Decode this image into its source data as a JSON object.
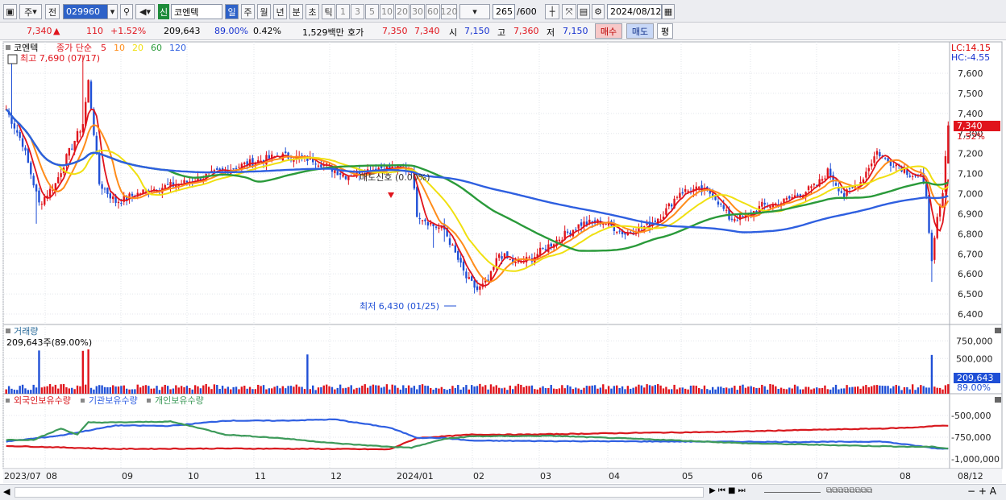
{
  "toolbar": {
    "type": "주",
    "prev": "전",
    "code": "029960",
    "new_badge": "신",
    "name": "코엔텍",
    "periods": [
      "일",
      "주",
      "월",
      "년",
      "분",
      "초",
      "틱"
    ],
    "intervals": [
      "1",
      "3",
      "5",
      "10",
      "20",
      "30",
      "60",
      "120"
    ],
    "count": "265",
    "count_total": "/600",
    "date": "2024/08/12"
  },
  "quote": {
    "price": "7,340",
    "arrow": "▲",
    "change": "110",
    "pct": "+1.52%",
    "volume": "209,643",
    "vol_ratio": "89.00%",
    "turnover": "0.42%",
    "amount": "1,529백만",
    "hoga_label": "호가",
    "ask": "7,350",
    "bid": "7,340",
    "open_label": "시",
    "open": "7,150",
    "high_label": "고",
    "high": "7,360",
    "low_label": "저",
    "low": "7,150",
    "buy": "매수",
    "sell": "매도",
    "eval": "평"
  },
  "price_pane": {
    "title": "코엔텍",
    "legend": [
      "종가 단순",
      "5",
      "10",
      "20",
      "60",
      "120"
    ],
    "high_note": "최고 7,690 (07/17)",
    "low_note": "최저 6,430 (01/25)",
    "signal": "매도신호 (0.00%)",
    "lc": "LC:14.15",
    "hc": "HC:-4.55",
    "last_tag": "7,340",
    "last_pct": "1.52%"
  },
  "volume_pane": {
    "title": "거래량",
    "note": "209,643주(89.00%)",
    "last": "209,643",
    "last_pct": "89.00%"
  },
  "holder_pane": {
    "series": [
      "외국인보유수량",
      "기관보유수량",
      "개인보유수량"
    ]
  },
  "x_labels": [
    "2023/07",
    "08",
    "09",
    "10",
    "11",
    "12",
    "2024/01",
    "02",
    "03",
    "04",
    "05",
    "06",
    "07",
    "08"
  ],
  "x_right": "08/12",
  "colors": {
    "ma5": "#e0141c",
    "ma10": "#ff8c1a",
    "ma20": "#f0e010",
    "ma60": "#2a9a3a",
    "ma120": "#2e5fe0",
    "up": "#e0141c",
    "down": "#1f4fd6",
    "foreign": "#d8171d",
    "inst": "#2f5fe2",
    "indiv": "#3d9a5a"
  },
  "chart_data": {
    "type": "candlestick",
    "price": {
      "y_ticks": [
        6400,
        6500,
        6600,
        6700,
        6800,
        6900,
        7000,
        7100,
        7200,
        7300,
        7400,
        7500,
        7600
      ],
      "ylim": [
        6350,
        7750
      ],
      "close_anchors": [
        [
          0,
          7420
        ],
        [
          6,
          7250
        ],
        [
          12,
          6950
        ],
        [
          18,
          7050
        ],
        [
          22,
          7180
        ],
        [
          28,
          7350
        ],
        [
          30,
          7560
        ],
        [
          34,
          7050
        ],
        [
          40,
          6960
        ],
        [
          52,
          7020
        ],
        [
          64,
          7050
        ],
        [
          76,
          7100
        ],
        [
          88,
          7150
        ],
        [
          100,
          7190
        ],
        [
          112,
          7170
        ],
        [
          124,
          7090
        ],
        [
          136,
          7130
        ],
        [
          148,
          7120
        ],
        [
          150,
          6900
        ],
        [
          156,
          6840
        ],
        [
          160,
          6820
        ],
        [
          164,
          6700
        ],
        [
          168,
          6580
        ],
        [
          172,
          6520
        ],
        [
          176,
          6560
        ],
        [
          180,
          6700
        ],
        [
          186,
          6650
        ],
        [
          192,
          6680
        ],
        [
          200,
          6760
        ],
        [
          210,
          6850
        ],
        [
          218,
          6860
        ],
        [
          226,
          6800
        ],
        [
          234,
          6840
        ],
        [
          240,
          6900
        ],
        [
          246,
          7010
        ],
        [
          252,
          7020
        ],
        [
          258,
          7000
        ],
        [
          264,
          6880
        ],
        [
          270,
          6880
        ],
        [
          276,
          6940
        ],
        [
          282,
          6950
        ],
        [
          290,
          7000
        ],
        [
          296,
          7040
        ],
        [
          300,
          7110
        ],
        [
          306,
          6990
        ],
        [
          312,
          7060
        ],
        [
          318,
          7210
        ],
        [
          322,
          7160
        ],
        [
          326,
          7140
        ],
        [
          330,
          7100
        ],
        [
          334,
          7080
        ],
        [
          336,
          7000
        ],
        [
          338,
          6650
        ],
        [
          340,
          6870
        ],
        [
          342,
          7000
        ],
        [
          344,
          7340
        ]
      ],
      "spikes": [
        [
          2,
          7690
        ],
        [
          28,
          7690
        ],
        [
          30,
          7470
        ],
        [
          11,
          6850
        ],
        [
          156,
          6730
        ],
        [
          160,
          6760
        ],
        [
          338,
          6560
        ]
      ]
    },
    "volume": {
      "y_ticks": [
        250000,
        500000,
        750000
      ],
      "n": 345
    },
    "holdings": {
      "y_ticks": [
        -1000000,
        -750000,
        -500000
      ],
      "foreign": [
        [
          0,
          -850
        ],
        [
          40,
          -885
        ],
        [
          80,
          -880
        ],
        [
          120,
          -885
        ],
        [
          140,
          -890
        ],
        [
          150,
          -760
        ],
        [
          170,
          -720
        ],
        [
          190,
          -720
        ],
        [
          200,
          -715
        ],
        [
          230,
          -700
        ],
        [
          260,
          -690
        ],
        [
          290,
          -668
        ],
        [
          320,
          -650
        ],
        [
          330,
          -640
        ],
        [
          340,
          -620
        ],
        [
          344,
          -615
        ]
      ],
      "inst": [
        [
          0,
          -800
        ],
        [
          20,
          -730
        ],
        [
          40,
          -615
        ],
        [
          60,
          -620
        ],
        [
          80,
          -560
        ],
        [
          100,
          -560
        ],
        [
          120,
          -545
        ],
        [
          140,
          -640
        ],
        [
          150,
          -755
        ],
        [
          160,
          -760
        ],
        [
          170,
          -790
        ],
        [
          200,
          -795
        ],
        [
          250,
          -800
        ],
        [
          290,
          -805
        ],
        [
          320,
          -800
        ],
        [
          334,
          -855
        ],
        [
          340,
          -880
        ],
        [
          344,
          -880
        ]
      ],
      "indiv": [
        [
          0,
          -780
        ],
        [
          10,
          -780
        ],
        [
          20,
          -650
        ],
        [
          26,
          -720
        ],
        [
          30,
          -580
        ],
        [
          40,
          -580
        ],
        [
          60,
          -570
        ],
        [
          70,
          -640
        ],
        [
          80,
          -720
        ],
        [
          100,
          -760
        ],
        [
          120,
          -820
        ],
        [
          140,
          -860
        ],
        [
          148,
          -870
        ],
        [
          160,
          -770
        ],
        [
          170,
          -740
        ],
        [
          200,
          -735
        ],
        [
          240,
          -780
        ],
        [
          270,
          -820
        ],
        [
          300,
          -840
        ],
        [
          330,
          -860
        ],
        [
          338,
          -860
        ],
        [
          344,
          -880
        ]
      ]
    }
  }
}
